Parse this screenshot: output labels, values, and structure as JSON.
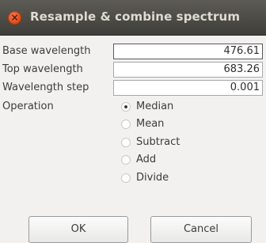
{
  "window": {
    "title": "Resample & combine spectrum",
    "close_glyph": "×"
  },
  "fields": {
    "base_wavelength": {
      "label": "Base wavelength",
      "value": "476.61"
    },
    "top_wavelength": {
      "label": "Top wavelength",
      "value": "683.26"
    },
    "wavelength_step": {
      "label": "Wavelength step",
      "value": "0.001"
    }
  },
  "operation": {
    "label": "Operation",
    "selected": "Median",
    "options": [
      "Median",
      "Mean",
      "Subtract",
      "Add",
      "Divide"
    ]
  },
  "buttons": {
    "ok": "OK",
    "cancel": "Cancel"
  }
}
